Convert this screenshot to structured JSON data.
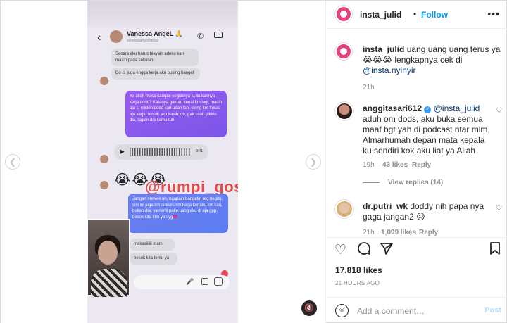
{
  "header": {
    "username": "insta_julid",
    "separator": "•",
    "follow_label": "Follow",
    "more_icon": "more-horizontal-icon"
  },
  "caption": {
    "username": "insta_julid",
    "text_line1": "uang uang uang terus ya",
    "text_line2": "😭😭😭 lengkapnya cek di",
    "text_line3": "@insta.nyinyir",
    "time": "21h"
  },
  "comments": [
    {
      "username": "anggitasari612",
      "verified": true,
      "lines": [
        "@insta_julid",
        "aduh om dods, aku buka semua",
        "maaf bgt yah di podcast ntar mlm,",
        "Almarhumah depan mata kepala",
        "ku sendiri kok aku liat ya Allah"
      ],
      "time": "19h",
      "likes": "43 likes",
      "reply_label": "Reply",
      "view_replies": "View replies (14)"
    },
    {
      "username": "dr.putri_wk",
      "lines": [
        "doddy nih papa nya",
        "gaga jangan2 😥"
      ],
      "time": "21h",
      "likes": "1,099 likes",
      "reply_label": "Reply"
    }
  ],
  "post": {
    "likes": "17,818 likes",
    "time_ago": "21 HOURS AGO"
  },
  "add_comment": {
    "placeholder": "Add a comment…",
    "post_label": "Post"
  },
  "media": {
    "chat_name": "Vanessa AngeL 🙏",
    "chat_handle": "vanessaangelofficial",
    "msg1": "Secara aku harus biayain adeku kan masih pada sekolah",
    "msg2": "Do ⚠ juga engga kerja aku pusing banget",
    "msg3": "Ya allah masa sampai segitunya si, bukannya kerja dodo? Katanya gamau kenal km lagi, masih aja si mikirin dodo kan udah lah, skrng km fokus aja kerja, besok aku kasih job, gak usah pikirin dia, lagian dia kamu tuh",
    "voice_time": "0:41",
    "emojis": "😭😭😭",
    "watermark": "@rumpi_gosip",
    "msg4": "Jangan mewek ah, ngapain bangetin org begitu, sini ini juga km sukses km kerja kerjaku km kan, bukan dia, ya nanti pake uang aku di aja gpp, besok kita ktm ya syg💗",
    "msg5": "makasiiiiii mam",
    "msg6": "besok kita temu ya"
  }
}
